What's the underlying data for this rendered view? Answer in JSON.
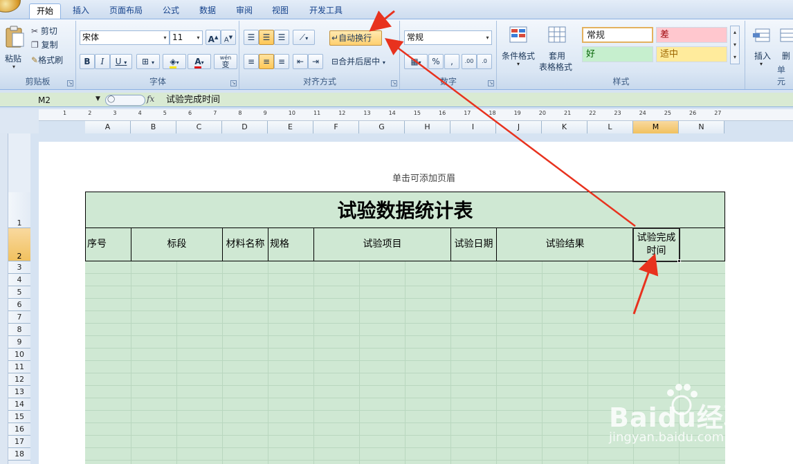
{
  "ribbon": {
    "tabs": [
      "开始",
      "插入",
      "页面布局",
      "公式",
      "数据",
      "审阅",
      "视图",
      "开发工具"
    ],
    "active_tab": "开始",
    "clipboard": {
      "paste": "粘贴",
      "cut": "剪切",
      "copy": "复制",
      "format_painter": "格式刷",
      "label": "剪贴板"
    },
    "font": {
      "name": "宋体",
      "size": "11",
      "grow": "A",
      "shrink": "A",
      "bold": "B",
      "italic": "I",
      "underline": "U",
      "phonetic": "wén",
      "phonetic_char": "变",
      "font_color_letter": "A",
      "label": "字体"
    },
    "alignment": {
      "wrap_text": "自动换行",
      "merge_center": "合并后居中",
      "label": "对齐方式"
    },
    "number": {
      "format": "常规",
      "percent": "%",
      "comma": ",",
      "inc_decimal": ".00",
      "dec_decimal": ".0",
      "label": "数字"
    },
    "styles": {
      "conditional": "条件格式",
      "table_format_1": "套用",
      "table_format_2": "表格格式",
      "normal": "常规",
      "bad": "差",
      "good": "好",
      "neutral": "适中",
      "label": "样式"
    },
    "cells": {
      "insert": "插入",
      "delete": "删",
      "label": "单元"
    }
  },
  "formula_bar": {
    "name_box": "M2",
    "fx": "fx",
    "content": "试验完成时间"
  },
  "ruler": {
    "ticks": [
      "1",
      "2",
      "3",
      "4",
      "5",
      "6",
      "7",
      "8",
      "9",
      "10",
      "11",
      "12",
      "13",
      "14",
      "15",
      "16",
      "17",
      "18",
      "19",
      "20",
      "21",
      "22",
      "23",
      "24",
      "25",
      "26",
      "27"
    ]
  },
  "columns": [
    "A",
    "B",
    "C",
    "D",
    "E",
    "F",
    "G",
    "H",
    "I",
    "J",
    "K",
    "L",
    "M",
    "N"
  ],
  "selected_column": "M",
  "rows": [
    "1",
    "2",
    "3",
    "4",
    "5",
    "6",
    "7",
    "8",
    "9",
    "10",
    "11",
    "12",
    "13",
    "14",
    "15",
    "16",
    "17",
    "18"
  ],
  "selected_row": "2",
  "page": {
    "header_hint": "单击可添加页眉"
  },
  "sheet": {
    "title": "试验数据统计表",
    "headers": {
      "seq": "序号",
      "section": "标段",
      "material": "材料名称",
      "spec": "规格",
      "item": "试验项目",
      "date": "试验日期",
      "result": "试验结果",
      "done_time_1": "试验完成",
      "done_time_2": "时间"
    }
  },
  "watermark": {
    "brand": "Baidu经验",
    "url": "jingyan.baidu.com"
  },
  "colors": {
    "annotation_arrow": "#e8321e",
    "sheet_fill": "#cfe8d3",
    "selected_header": "#f1c15f"
  }
}
